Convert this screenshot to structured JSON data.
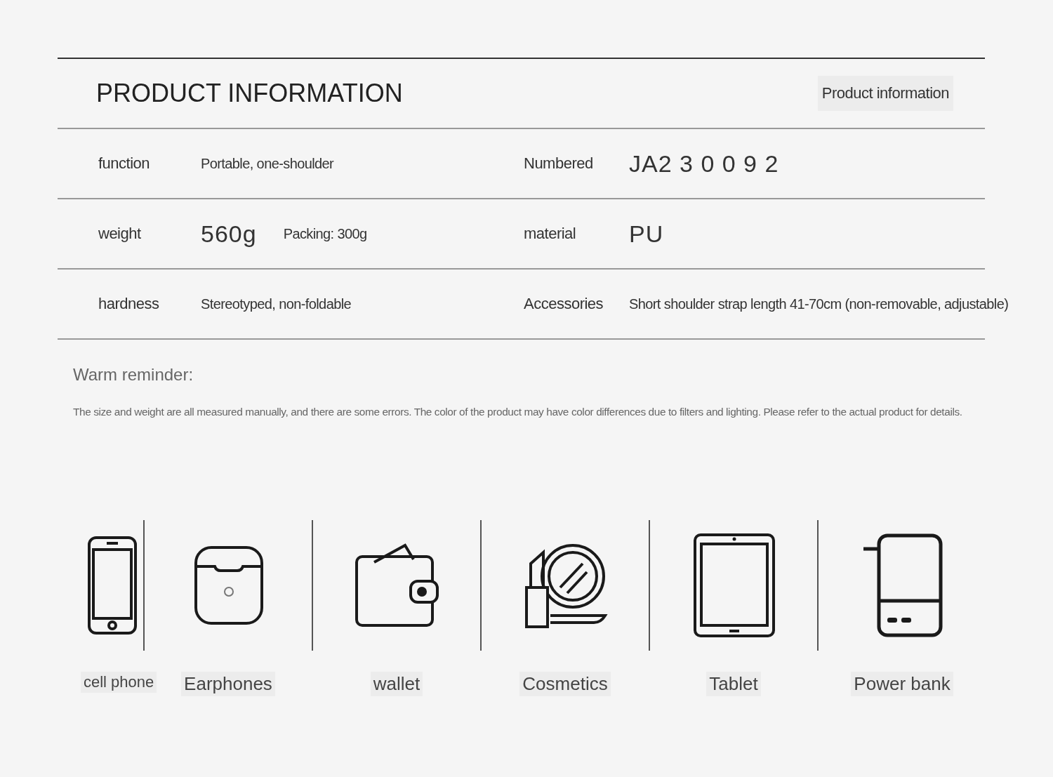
{
  "header": {
    "title": "PRODUCT INFORMATION",
    "tag": "Product information"
  },
  "rows": [
    {
      "pairs": [
        {
          "label": "function",
          "values": [
            {
              "text": "Portable, one-shoulder",
              "large": false
            }
          ]
        },
        {
          "label": "Numbered",
          "values": [
            {
              "text": "JA2 3 0 0 9 2",
              "large": true
            }
          ]
        }
      ]
    },
    {
      "pairs": [
        {
          "label": "weight",
          "values": [
            {
              "text": "560g",
              "large": true
            },
            {
              "text": "Packing: 300g",
              "large": false
            }
          ]
        },
        {
          "label": "material",
          "values": [
            {
              "text": "PU",
              "large": true
            }
          ]
        }
      ]
    },
    {
      "pairs": [
        {
          "label": "hardness",
          "values": [
            {
              "text": "Stereotyped, non-foldable",
              "large": false
            }
          ]
        },
        {
          "label": "Accessories",
          "values": [
            {
              "text": "Short shoulder strap length 41-70cm (non-removable, adjustable)",
              "large": false
            }
          ]
        }
      ]
    }
  ],
  "reminder": {
    "title": "Warm reminder:",
    "text": "The size and weight are all measured manually, and there are some errors. The color of the product may have color differences due to filters and lighting. Please refer to the actual product for details."
  },
  "capacity": [
    {
      "kind": "phone",
      "label": "cell phone"
    },
    {
      "kind": "earphones",
      "label": "Earphones"
    },
    {
      "kind": "wallet",
      "label": "wallet"
    },
    {
      "kind": "cosmetics",
      "label": "Cosmetics"
    },
    {
      "kind": "tablet",
      "label": "Tablet"
    },
    {
      "kind": "powerbank",
      "label": "Power bank"
    }
  ]
}
